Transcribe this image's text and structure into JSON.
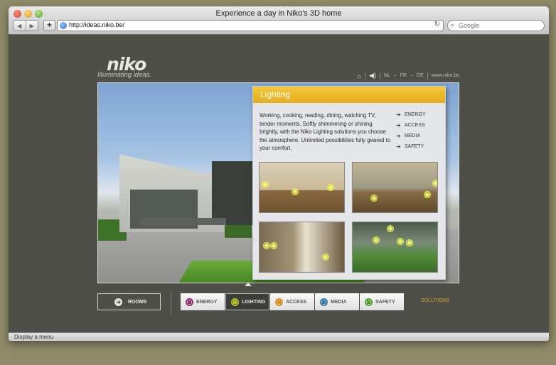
{
  "window": {
    "title": "Experience a day in Niko's 3D home"
  },
  "toolbar": {
    "url": "http://ideas.niko.be/",
    "search_placeholder": "Google",
    "add_label": "+"
  },
  "header": {
    "logo": "niko",
    "tagline": "Illuminating ideas.",
    "languages": [
      "NL",
      "FR",
      "DE"
    ],
    "website": "www.niko.be"
  },
  "panel": {
    "title": "Lighting",
    "description": "Working, cooking, reading, dining, watching TV, tender moments. Softly shimmering or shining brightly, with the Niko Lighting solutions you choose the atmosphere. Unlimited possibilities fully geared to your comfort.",
    "nav": [
      "ENERGY",
      "ACCESS",
      "MEDIA",
      "SAFETY"
    ]
  },
  "bottom": {
    "rooms_label": "ROOMS",
    "tabs": [
      {
        "label": "ENERGY",
        "color": "#8e2a6c",
        "active": false
      },
      {
        "label": "LIGHTING",
        "color": "#b9c21f",
        "active": true
      },
      {
        "label": "ACCESS",
        "color": "#e08a1e",
        "active": false
      },
      {
        "label": "MEDIA",
        "color": "#2e78a8",
        "active": false
      },
      {
        "label": "SAFETY",
        "color": "#4e9a2e",
        "active": false
      }
    ],
    "solutions_label": "SOLUTIONS"
  },
  "status": {
    "text": "Display a menu"
  },
  "colors": {
    "accent": "#e5ad1c",
    "background": "#4f4f49"
  }
}
